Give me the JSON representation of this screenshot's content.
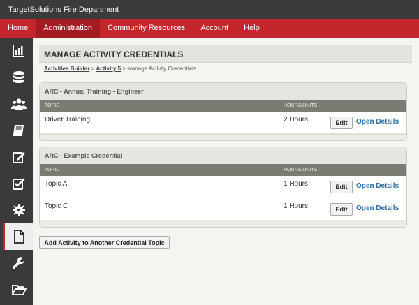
{
  "app": {
    "title": "TargetSolutions Fire Department"
  },
  "nav": {
    "items": [
      {
        "label": "Home"
      },
      {
        "label": "Administration"
      },
      {
        "label": "Community Resources"
      },
      {
        "label": "Account"
      },
      {
        "label": "Help"
      }
    ],
    "active": "Administration"
  },
  "sidebar": {
    "items": [
      {
        "icon": "bar-chart-icon"
      },
      {
        "icon": "database-icon"
      },
      {
        "icon": "users-icon"
      },
      {
        "icon": "book-icon"
      },
      {
        "icon": "edit-icon"
      },
      {
        "icon": "checkbox-icon"
      },
      {
        "icon": "gear-icon"
      },
      {
        "icon": "document-icon",
        "active": true
      },
      {
        "icon": "wrench-icon"
      },
      {
        "icon": "folder-open-icon"
      }
    ]
  },
  "page": {
    "title": "MANAGE ACTIVITY CREDENTIALS",
    "breadcrumb": {
      "crumb1": "Activities Builder",
      "sep1": " > ",
      "crumb2": "Activity 5",
      "sep2": " > ",
      "current": "Manage Activity Credentials"
    }
  },
  "panels": [
    {
      "title": "ARC - Annual Training - Engineer",
      "col_topic": "TOPIC",
      "col_hours": "HOURS/UNITS",
      "rows": [
        {
          "topic": "Driver Training",
          "hours": "2 Hours",
          "edit": "Edit",
          "open": "Open Details"
        }
      ]
    },
    {
      "title": "ARC - Example Credential",
      "col_topic": "TOPIC",
      "col_hours": "HOURS/UNITS",
      "rows": [
        {
          "topic": "Topic A",
          "hours": "1 Hours",
          "edit": "Edit",
          "open": "Open Details"
        },
        {
          "topic": "Topic C",
          "hours": "1 Hours",
          "edit": "Edit",
          "open": "Open Details"
        }
      ]
    }
  ],
  "actions": {
    "add_label": "Add Activity to Another Credential Topic"
  },
  "colors": {
    "brand_red": "#c4262e",
    "nav_dark": "#3b3b3b",
    "link_blue": "#2c6ea5"
  }
}
